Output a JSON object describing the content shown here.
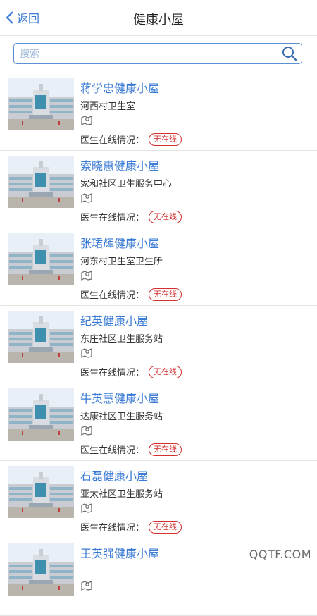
{
  "nav": {
    "back_label": "返回",
    "title": "健康小屋"
  },
  "search": {
    "placeholder": "搜索"
  },
  "status_label": "医生在线情况：",
  "items": [
    {
      "name": "蒋学忠健康小屋",
      "address": "河西村卫生室",
      "status": "无在线"
    },
    {
      "name": "索晓惠健康小屋",
      "address": "家和社区卫生服务中心",
      "status": "无在线"
    },
    {
      "name": "张珺辉健康小屋",
      "address": "河东村卫生室卫生所",
      "status": "无在线"
    },
    {
      "name": "纪英健康小屋",
      "address": "东庄社区卫生服务站",
      "status": "无在线"
    },
    {
      "name": "牛英慧健康小屋",
      "address": "达康社区卫生服务站",
      "status": "无在线"
    },
    {
      "name": "石磊健康小屋",
      "address": "亚太社区卫生服务站",
      "status": "无在线"
    },
    {
      "name": "王英强健康小屋",
      "address": "",
      "status": ""
    }
  ],
  "watermark": "QQTF.COM",
  "colors": {
    "accent": "#3a7bd5",
    "status_red": "#d32f2f"
  }
}
